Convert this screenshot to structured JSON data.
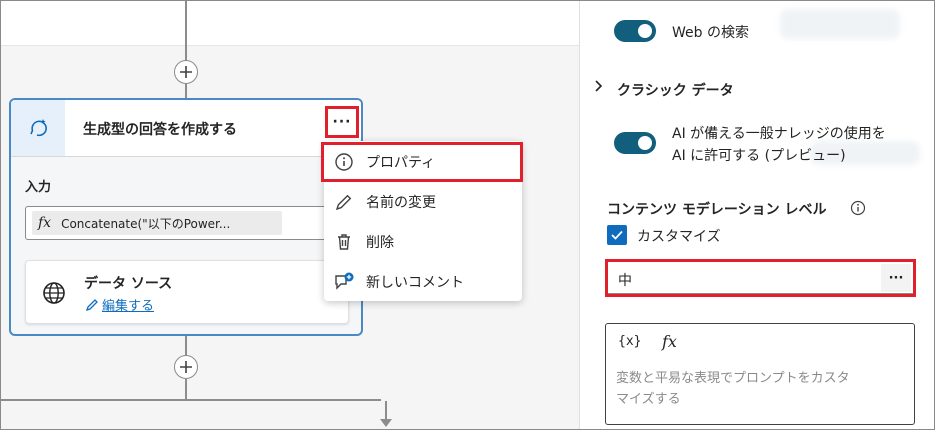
{
  "canvas": {
    "node": {
      "title": "生成型の回答を作成する",
      "more_label": "···",
      "input_label": "入力",
      "formula_text": "Concatenate(\"以下のPower...",
      "datasource": {
        "title": "データ ソース",
        "edit_link": "編集する"
      }
    },
    "context_menu": {
      "items": [
        {
          "label": "プロパティ",
          "icon": "info-icon"
        },
        {
          "label": "名前の変更",
          "icon": "pencil-icon"
        },
        {
          "label": "削除",
          "icon": "trash-icon"
        },
        {
          "label": "新しいコメント",
          "icon": "comment-add-icon"
        }
      ]
    }
  },
  "panel": {
    "web_search": {
      "label": "Web の検索",
      "enabled": true
    },
    "classic_data": {
      "label": "クラシック データ"
    },
    "general_knowledge": {
      "line1": "AI が備える一般ナレッジの使用を",
      "line2": "AI に許可する (プレビュー)",
      "enabled": true
    },
    "moderation": {
      "label": "コンテンツ モデレーション レベル",
      "customize_label": "カスタマイズ",
      "customize_checked": true,
      "level_value": "中",
      "more_label": "···"
    },
    "prompt": {
      "var_tool": "{x}",
      "fx_tool": "fx",
      "placeholder_line1": "変数と平易な表現でプロンプトをカスタ",
      "placeholder_line2": "マイズする"
    }
  },
  "colors": {
    "accent": "#0f6cbd",
    "toggle_on": "#115e7d",
    "highlight": "#e0202c"
  }
}
